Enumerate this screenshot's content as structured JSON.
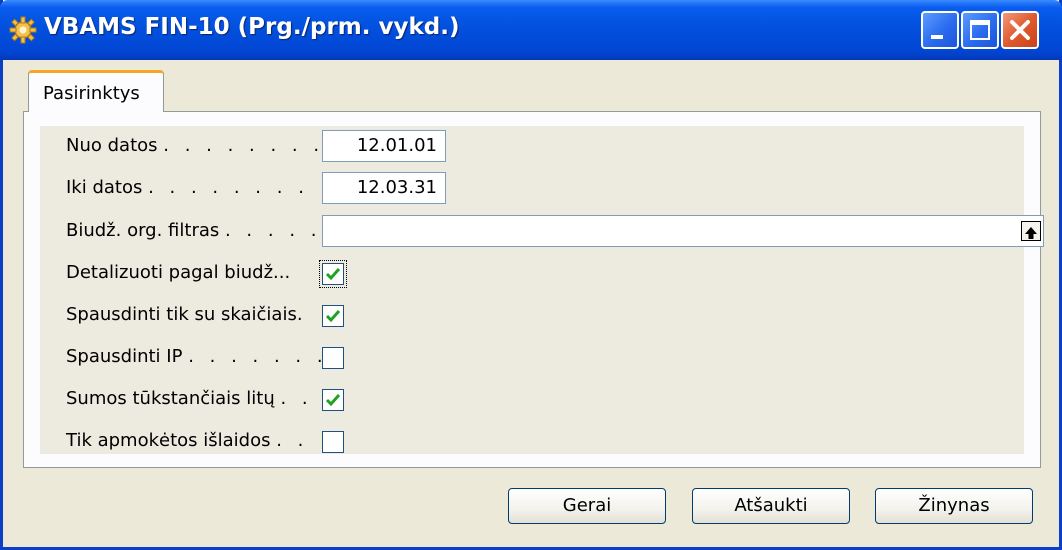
{
  "window": {
    "title": "VBAMS FIN-10 (Prg./prm. vykd.)"
  },
  "tabs": [
    {
      "label": "Pasirinktys"
    }
  ],
  "fields": {
    "from_date": {
      "label": "Nuo datos",
      "dots": ". . . . . . . .",
      "value": "12.01.01"
    },
    "to_date": {
      "label": "Iki datos",
      "dots": ". . . . . . . .",
      "value": "12.03.31"
    },
    "budget_filter": {
      "label": "Biudž. org. filtras",
      "dots": ". . . . .",
      "value": ""
    }
  },
  "checkboxes": [
    {
      "label": "Detalizuoti pagal biudž...",
      "dots": "",
      "checked": true
    },
    {
      "label": "Spausdinti tik su skaičiais",
      "dots": ".",
      "checked": true
    },
    {
      "label": "Spausdinti IP",
      "dots": ". . . . . . .",
      "checked": false
    },
    {
      "label": "Sumos tūkstančiais litų",
      "dots": ". .",
      "checked": true
    },
    {
      "label": "Tik apmokėtos išlaidos",
      "dots": ". .",
      "checked": false
    }
  ],
  "buttons": {
    "ok": "Gerai",
    "cancel": "Atšaukti",
    "help": "Žinynas"
  },
  "colors": {
    "titlebar": "#0352E0",
    "check": "#21A121",
    "tab_accent": "#F5A623",
    "dialog": "#ECE9D8"
  }
}
